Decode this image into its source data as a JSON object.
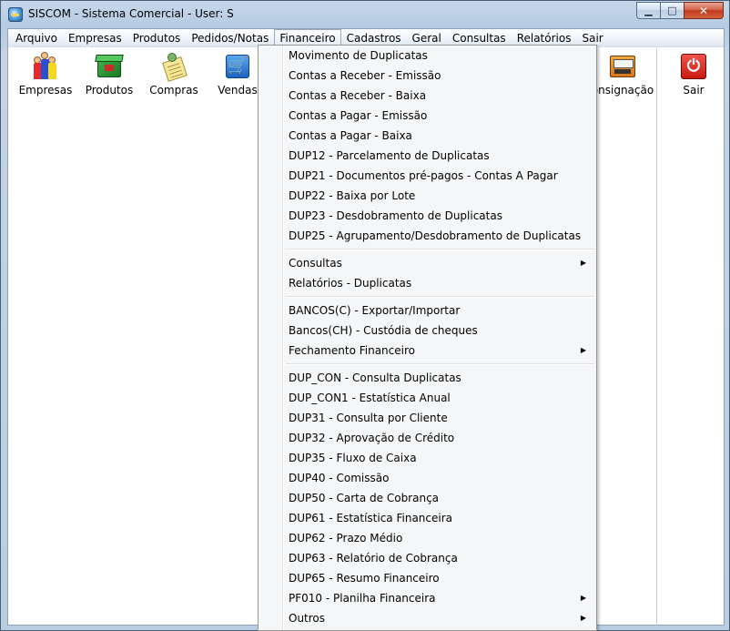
{
  "window": {
    "title": "SISCOM - Sistema Comercial - User: S",
    "buttons": {
      "minimize": "▁",
      "maximize": "□",
      "close": "✕"
    }
  },
  "menubar": {
    "items": [
      "Arquivo",
      "Empresas",
      "Produtos",
      "Pedidos/Notas",
      "Financeiro",
      "Cadastros",
      "Geral",
      "Consultas",
      "Relatórios",
      "Sair"
    ],
    "active": "Financeiro"
  },
  "toolbar": {
    "buttons": [
      {
        "label": "Empresas",
        "icon": "people-icon"
      },
      {
        "label": "Produtos",
        "icon": "box-icon"
      },
      {
        "label": "Compras",
        "icon": "notepad-icon"
      },
      {
        "label": "Vendas",
        "icon": "cart-icon"
      },
      {
        "label": "Consignação",
        "label_visible": "onsignação",
        "icon": "scanner-icon"
      },
      {
        "label": "Sair",
        "icon": "power-icon"
      }
    ]
  },
  "financeiro_menu": {
    "groups": [
      [
        {
          "label": "Movimento de Duplicatas"
        },
        {
          "label": "Contas a Receber - Emissão"
        },
        {
          "label": "Contas a Receber - Baixa"
        },
        {
          "label": "Contas a Pagar - Emissão"
        },
        {
          "label": "Contas a Pagar - Baixa"
        },
        {
          "label": "DUP12 - Parcelamento de Duplicatas"
        },
        {
          "label": "DUP21 - Documentos pré-pagos - Contas A Pagar"
        },
        {
          "label": "DUP22 - Baixa por Lote"
        },
        {
          "label": "DUP23 - Desdobramento de Duplicatas"
        },
        {
          "label": "DUP25 - Agrupamento/Desdobramento de Duplicatas"
        }
      ],
      [
        {
          "label": "Consultas",
          "submenu": true
        },
        {
          "label": "Relatórios - Duplicatas"
        }
      ],
      [
        {
          "label": "BANCOS(C) - Exportar/Importar"
        },
        {
          "label": "Bancos(CH) - Custódia de cheques"
        },
        {
          "label": "Fechamento Financeiro",
          "submenu": true
        }
      ],
      [
        {
          "label": "DUP_CON - Consulta Duplicatas"
        },
        {
          "label": "DUP_CON1 - Estatística Anual"
        },
        {
          "label": "DUP31 - Consulta por Cliente"
        },
        {
          "label": "DUP32 - Aprovação de Crédito"
        },
        {
          "label": "DUP35 - Fluxo de Caixa"
        },
        {
          "label": "DUP40 - Comissão"
        },
        {
          "label": "DUP50 - Carta de Cobrança"
        },
        {
          "label": "DUP61 - Estatística Financeira"
        },
        {
          "label": "DUP62 - Prazo Médio"
        },
        {
          "label": "DUP63 - Relatório de Cobrança"
        },
        {
          "label": "DUP65 - Resumo Financeiro"
        },
        {
          "label": "PF010 - Planilha Financeira",
          "submenu": true
        },
        {
          "label": "Outros",
          "submenu": true
        }
      ]
    ],
    "submenu_arrow": "▶"
  }
}
